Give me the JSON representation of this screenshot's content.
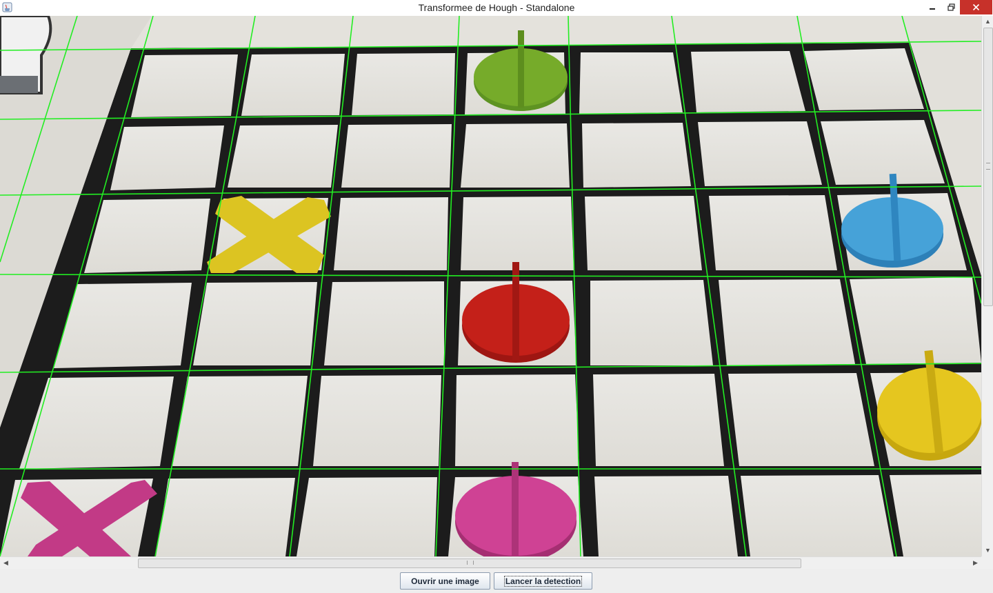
{
  "window": {
    "title": "Transformee de Hough - Standalone",
    "icon": "java-app-icon",
    "controls": [
      "minimize-icon",
      "restore-icon",
      "close-icon"
    ]
  },
  "image": {
    "description_icons": "checkerboard-photo-with-detected-lines",
    "line_color": "#22ee22",
    "pieces": [
      {
        "shape": "pawn",
        "color": "#6fa524"
      },
      {
        "shape": "pawn",
        "color": "#3f9ad3"
      },
      {
        "shape": "pawn",
        "color": "#c0201a"
      },
      {
        "shape": "pawn",
        "color": "#e0c41c"
      },
      {
        "shape": "pawn",
        "color": "#cc3a8e"
      },
      {
        "shape": "cross",
        "color": "#dcc41e"
      },
      {
        "shape": "cross",
        "color": "#c23a86"
      }
    ]
  },
  "buttons": {
    "open_label": "Ouvrir une image",
    "detect_label": "Lancer la detection"
  },
  "colors": {
    "close_button": "#c7312a",
    "board_tile": "#e4e2dc",
    "board_line": "#1c1c1c"
  }
}
